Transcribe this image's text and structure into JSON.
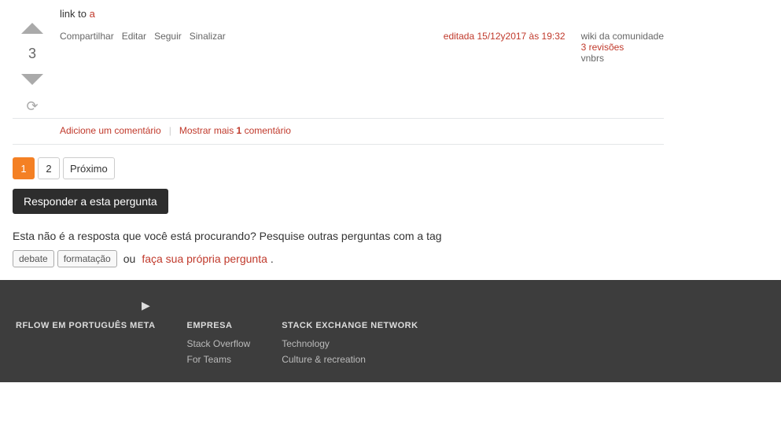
{
  "post": {
    "link_to_label": "link to ",
    "link_text": "a",
    "vote_count": "3",
    "actions": [
      {
        "label": "Compartilhar",
        "name": "share"
      },
      {
        "label": "Editar",
        "name": "edit"
      },
      {
        "label": "Seguir",
        "name": "follow"
      },
      {
        "label": "Sinalizar",
        "name": "flag"
      }
    ],
    "edit_info": "editada 15/12y2017 às 19:32",
    "community_wiki_label": "wiki da comunidade",
    "revisions_label": "3 revisões",
    "author_label": "vnbrs"
  },
  "comments": {
    "add_label": "Adicione um comentário",
    "show_more_label": "Mostrar mais ",
    "show_more_count": "1",
    "show_more_suffix": " comentário"
  },
  "pagination": {
    "pages": [
      {
        "label": "1",
        "active": true
      },
      {
        "label": "2",
        "active": false
      }
    ],
    "next_label": "Próximo"
  },
  "answer_btn_label": "Responder a esta pergunta",
  "not_answer": {
    "text": "Esta não é a resposta que você está procurando? Pesquise outras perguntas com a tag",
    "tags": [
      "debate",
      "formatação"
    ],
    "or_label": "ou",
    "ask_link_label": "faça sua própria pergunta",
    "period": "."
  },
  "footer": {
    "columns": [
      {
        "title": "RFLOW EM PORTUGUÊS META",
        "links": []
      },
      {
        "title": "EMPRESA",
        "links": [
          {
            "label": "Stack Overflow"
          },
          {
            "label": "For Teams"
          }
        ]
      },
      {
        "title": "STACK EXCHANGE NETWORK",
        "links": [
          {
            "label": "Technology"
          },
          {
            "label": "Culture & recreation"
          }
        ]
      }
    ]
  },
  "colors": {
    "accent": "#c0392b",
    "dark_bg": "#3d3d3d",
    "answer_btn_bg": "#2d2d2d"
  }
}
